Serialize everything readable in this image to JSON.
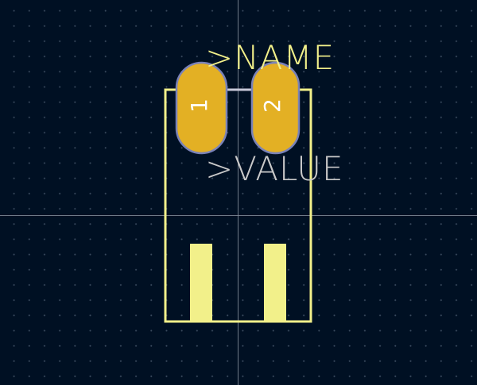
{
  "footprint": {
    "name_text": ">NAME",
    "value_text": ">VALUE",
    "pads": [
      {
        "number": "1"
      },
      {
        "number": "2"
      }
    ]
  },
  "colors": {
    "background": "#001023",
    "silkscreen": "#f2f08a",
    "value_text": "#c9c9c9",
    "pad_fill": "#e3b024",
    "pad_outline": "#7a82b8",
    "crosshair": "#8a93a0"
  }
}
